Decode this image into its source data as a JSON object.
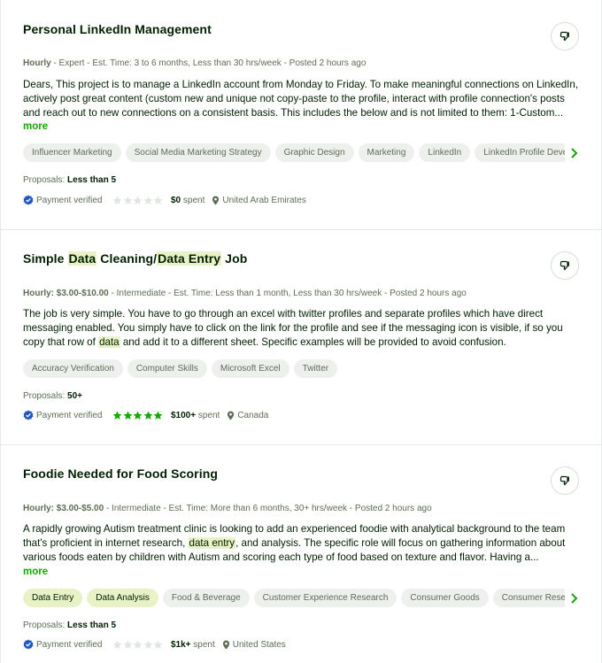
{
  "jobs": [
    {
      "title": "Personal LinkedIn Management",
      "meta": {
        "type": "Hourly",
        "rest": " - Expert - Est. Time: 3 to 6 months, Less than 30 hrs/week - Posted 2 hours ago"
      },
      "description": "Dears, This project is to manage a LinkedIn account from Monday to Friday. To make meaningful connections on LinkedIn, actively post great content (custom new and unique not copy-paste to the profile, interact with profile connection's posts and reach out to new connections on a consistent basis. This includes the below and is not limited to them: 1-Custom...",
      "more_label": "more",
      "skills": [
        "Influencer Marketing",
        "Social Media Marketing Strategy",
        "Graphic Design",
        "Marketing",
        "LinkedIn",
        "LinkedIn Profile Development"
      ],
      "proposals_label": "Proposals:",
      "proposals_value": "Less than 5",
      "payment_verified": "Payment verified",
      "rating": 0,
      "spent_value": "$0",
      "spent_label": " spent",
      "country": "United Arab Emirates"
    },
    {
      "title_parts": [
        "Simple ",
        "Data",
        " Cleaning/",
        "Data Entry",
        " Job"
      ],
      "meta": {
        "type": "Hourly: $3.00-$10.00",
        "rest": " - Intermediate - Est. Time: Less than 1 month, Less than 30 hrs/week - Posted 2 hours ago"
      },
      "description_parts": [
        "The job is very simple. You have to go through an excel with twitter profiles and separate profiles which have direct messaging enabled. You simply have to click on the link for the profile and see if the messaging icon is visible, if so you copy that row of ",
        "data",
        " and add it to a different sheet. Specific examples will be provided to avoid confusion."
      ],
      "skills": [
        "Accuracy Verification",
        "Computer Skills",
        "Microsoft Excel",
        "Twitter"
      ],
      "proposals_label": "Proposals:",
      "proposals_value": "50+",
      "payment_verified": "Payment verified",
      "rating": 5,
      "spent_value": "$100+",
      "spent_label": " spent",
      "country": "Canada"
    },
    {
      "title": "Foodie Needed for Food Scoring",
      "meta": {
        "type": "Hourly: $3.00-$5.00",
        "rest": " - Intermediate - Est. Time: More than 6 months, 30+ hrs/week - Posted 2 hours ago"
      },
      "description_parts": [
        "A rapidly growing Autism treatment clinic is looking to add an experienced foodie with analytical background to the team that's proficient in internet research, ",
        "data entry",
        ", and analysis. The specific role will focus on gathering information about various foods eaten by children with Autism and scoring each type of food based on texture and flavor. Having a..."
      ],
      "more_label": "more",
      "skills": [
        "Data Entry",
        "Data Analysis",
        "Food & Beverage",
        "Customer Experience Research",
        "Consumer Goods",
        "Consumer Research"
      ],
      "proposals_label": "Proposals:",
      "proposals_value": "Less than 5",
      "payment_verified": "Payment verified",
      "rating": 0,
      "spent_value": "$1k+",
      "spent_label": " spent",
      "country": "United States"
    }
  ],
  "colors": {
    "accent_green": "#14a800",
    "highlight": "#e9f2c6",
    "verified_blue": "#1f57c3",
    "star_filled": "#14a800",
    "star_empty": "#e0e6e0"
  },
  "icons": {
    "dislike": "thumbs-down-icon",
    "verified": "verified-badge-icon",
    "location": "location-pin-icon",
    "scroll": "chevron-right-icon",
    "star": "star-icon"
  }
}
